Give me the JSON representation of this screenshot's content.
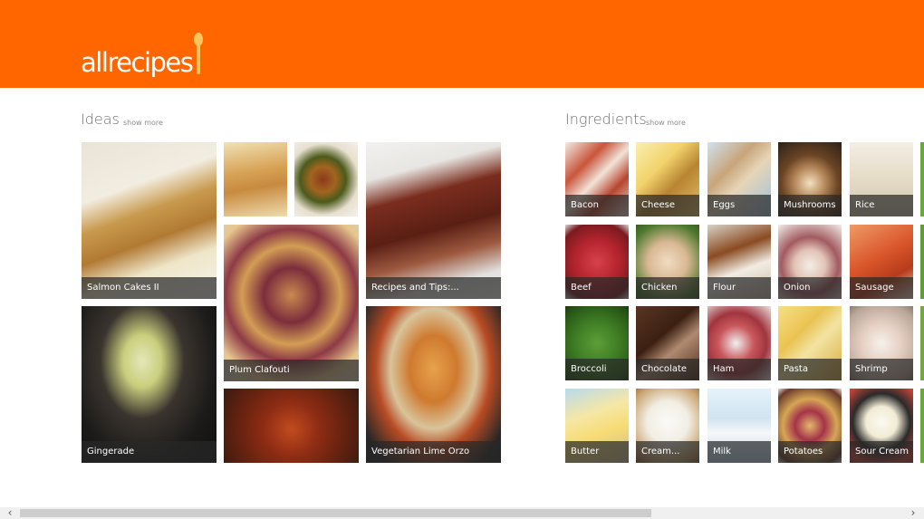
{
  "app": {
    "logo_text": "allrecipes"
  },
  "ideas": {
    "title": "Ideas",
    "show_more": "show more",
    "tiles": [
      {
        "label": "Salmon Cakes II"
      },
      {
        "label": ""
      },
      {
        "label": ""
      },
      {
        "label": "Recipes and Tips:..."
      },
      {
        "label": "Gingerade"
      },
      {
        "label": "Plum Clafouti"
      },
      {
        "label": ""
      },
      {
        "label": "Vegetarian Lime Orzo"
      }
    ]
  },
  "ingredients": {
    "title": "Ingredients",
    "show_more": "show more",
    "items": [
      "Bacon",
      "Cheese",
      "Eggs",
      "Mushrooms",
      "Rice",
      "Beef",
      "Chicken",
      "Flour",
      "Onion",
      "Sausage",
      "Broccoli",
      "Chocolate",
      "Ham",
      "Pasta",
      "Shrimp",
      "Butter",
      "Cream...",
      "Milk",
      "Potatoes",
      "Sour Cream"
    ]
  },
  "scroll": {
    "left_arrow": "‹",
    "right_arrow": "›"
  },
  "colors": {
    "brand": "#ff6600",
    "logo_spoon": "#f9c35d",
    "label_bg": "#282828"
  }
}
